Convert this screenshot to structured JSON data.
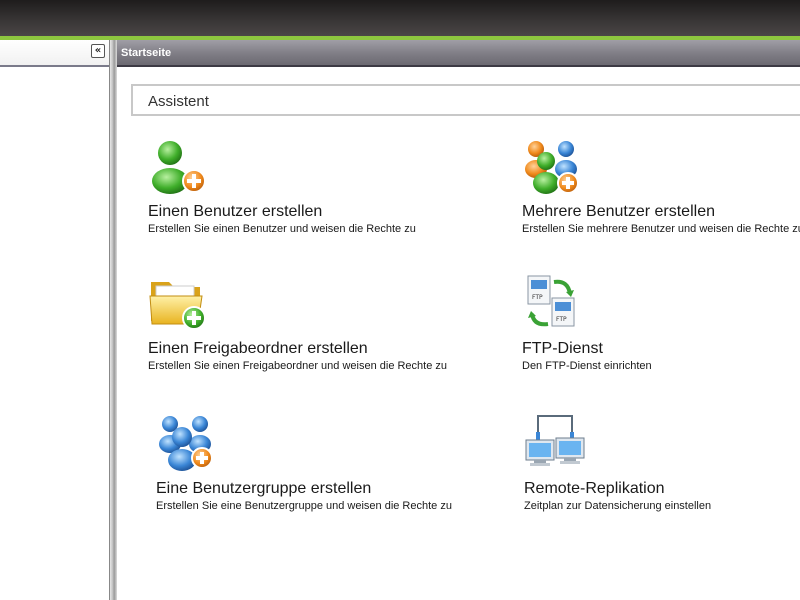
{
  "header": {
    "tab_title": "Startseite",
    "collapse_icon": "double-chevron-left-icon"
  },
  "section": {
    "title": "Assistent"
  },
  "items": [
    {
      "title": "Einen Benutzer erstellen",
      "desc": "Erstellen Sie einen Benutzer und weisen die Rechte zu",
      "icon": "add-user-icon"
    },
    {
      "title": "Mehrere Benutzer erstellen",
      "desc": "Erstellen Sie mehrere Benutzer und weisen die Rechte zu",
      "icon": "add-multiple-users-icon"
    },
    {
      "title": "Einen Freigabeordner erstellen",
      "desc": "Erstellen Sie einen Freigabeordner und weisen die Rechte zu",
      "icon": "add-shared-folder-icon"
    },
    {
      "title": "FTP-Dienst",
      "desc": "Den FTP-Dienst einrichten",
      "icon": "ftp-icon"
    },
    {
      "title": "Eine Benutzergruppe erstellen",
      "desc": "Erstellen Sie eine Benutzergruppe und weisen die Rechte zu",
      "icon": "add-user-group-icon"
    },
    {
      "title": "Remote-Replikation",
      "desc": "Zeitplan zur Datensicherung einstellen",
      "icon": "remote-replication-icon"
    }
  ]
}
